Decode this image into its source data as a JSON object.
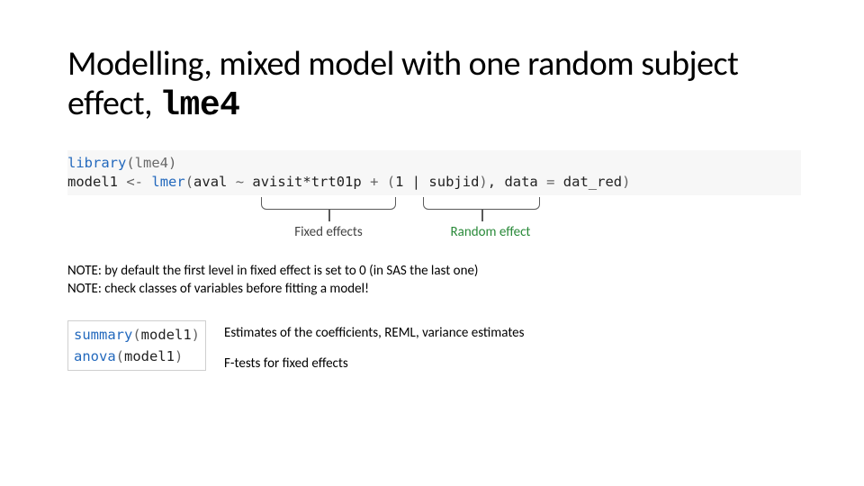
{
  "title": {
    "prefix": "Modelling, mixed model with one random subject effect, ",
    "package": "lme4"
  },
  "code1": {
    "library_fn": "library",
    "library_arg": "lme4",
    "model_var": "model1",
    "assign_op": "<-",
    "lmer_fn": "lmer",
    "formula_lhs": "aval",
    "tilde": "~",
    "fixed_term": "avisit*trt01p",
    "plus": "+",
    "random_term_open": "(",
    "random_term": "1 | subjid",
    "random_term_close": ")",
    "data_kw": "data",
    "eq": "=",
    "data_val": "dat_red"
  },
  "bracket_labels": {
    "fixed": "Fixed effects",
    "random": "Random effect"
  },
  "notes": {
    "line1": "NOTE: by default the first level in fixed effect is set to 0 (in SAS the last one)",
    "line2": "NOTE: check classes of variables before fitting a model!"
  },
  "code2": {
    "summary_fn": "summary",
    "anova_fn": "anova",
    "arg": "model1"
  },
  "desc": {
    "summary": "Estimates of the coefficients, REML, variance estimates",
    "anova": "F-tests for fixed effects"
  }
}
